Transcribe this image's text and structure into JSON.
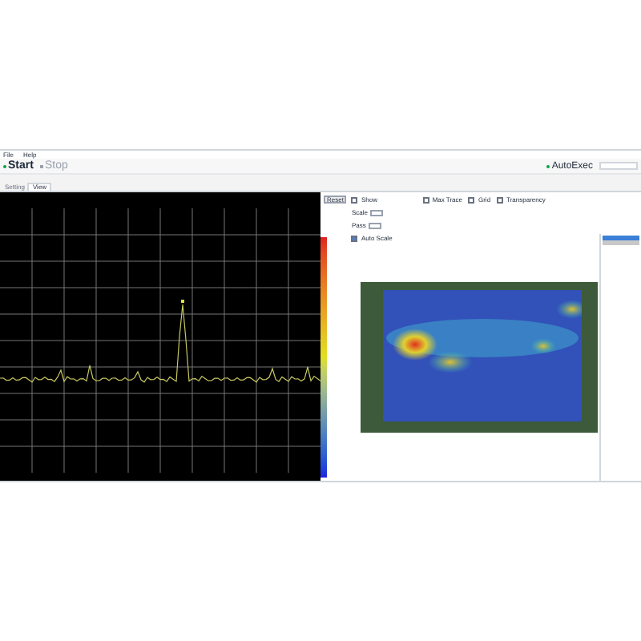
{
  "menu": [
    "File",
    "Help"
  ],
  "toolbar": {
    "start": "Start",
    "stop": "Stop",
    "autoexec": "AutoExec"
  },
  "tabs": [
    {
      "label": "Setting",
      "selected": false
    },
    {
      "label": "View",
      "selected": true
    }
  ],
  "controls": {
    "reset": "Reset",
    "show": {
      "label": "Show",
      "checked": false
    },
    "scale_label": "Scale",
    "pass_label": "Pass",
    "auto_scale": {
      "label": "Auto Scale",
      "checked": true
    },
    "max_trace": {
      "label": "Max Trace",
      "checked": false
    },
    "grid": {
      "label": "Grid",
      "checked": false
    },
    "transparency": {
      "label": "Transparency",
      "checked": false
    }
  },
  "list": [
    {
      "selected": true
    },
    {
      "selected": false
    }
  ]
}
